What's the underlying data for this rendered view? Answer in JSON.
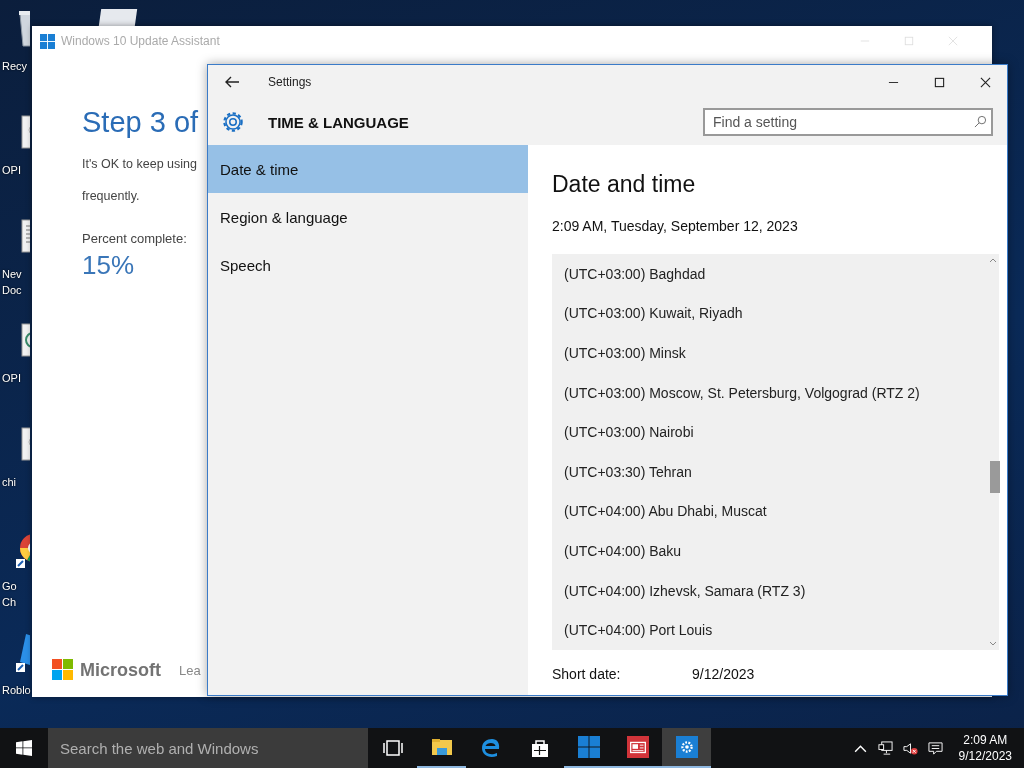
{
  "desktop": {
    "icons": [
      {
        "kind": "recycle-bin",
        "label": "Recy"
      },
      {
        "kind": "document",
        "label": "OPI"
      },
      {
        "kind": "text-document",
        "label": "Nev Doc"
      },
      {
        "kind": "web-document",
        "label": "OPI"
      },
      {
        "kind": "document",
        "label": "chi"
      },
      {
        "kind": "chrome",
        "label": "Go Ch"
      },
      {
        "kind": "roblox",
        "label": "Roblo"
      }
    ]
  },
  "update_assistant": {
    "title": "Windows 10 Update Assistant",
    "heading": "Step 3 of",
    "body_lines": [
      "It's OK to keep using",
      "frequently."
    ],
    "percent_label": "Percent complete:",
    "percent": "15%",
    "brand": "Microsoft",
    "footer_link": "Lea"
  },
  "settings": {
    "title": "Settings",
    "section": "TIME & LANGUAGE",
    "search": {
      "placeholder": "Find a setting"
    },
    "nav": [
      {
        "label": "Date & time",
        "selected": true
      },
      {
        "label": "Region & language",
        "selected": false
      },
      {
        "label": "Speech",
        "selected": false
      }
    ],
    "page_title": "Date and time",
    "current_datetime": "2:09 AM, Tuesday, September 12, 2023",
    "timezone_list": [
      "(UTC+03:00) Baghdad",
      "(UTC+03:00) Kuwait, Riyadh",
      "(UTC+03:00) Minsk",
      "(UTC+03:00) Moscow, St. Petersburg, Volgograd (RTZ 2)",
      "(UTC+03:00) Nairobi",
      "(UTC+03:30) Tehran",
      "(UTC+04:00) Abu Dhabi, Muscat",
      "(UTC+04:00) Baku",
      "(UTC+04:00) Izhevsk, Samara (RTZ 3)",
      "(UTC+04:00) Port Louis"
    ],
    "short_date": {
      "label": "Short date:",
      "value": "9/12/2023"
    }
  },
  "taskbar": {
    "search": {
      "placeholder": "Search the web and Windows"
    },
    "apps": [
      {
        "kind": "task-view",
        "running": false,
        "active": false
      },
      {
        "kind": "file-explorer",
        "running": true,
        "active": false
      },
      {
        "kind": "edge",
        "running": false,
        "active": false
      },
      {
        "kind": "store",
        "running": false,
        "active": false
      },
      {
        "kind": "windows-app",
        "running": true,
        "active": false
      },
      {
        "kind": "news",
        "running": true,
        "active": false
      },
      {
        "kind": "settings",
        "running": true,
        "active": true
      }
    ],
    "tray": {
      "time": "2:09 AM",
      "date": "9/12/2023"
    }
  }
}
